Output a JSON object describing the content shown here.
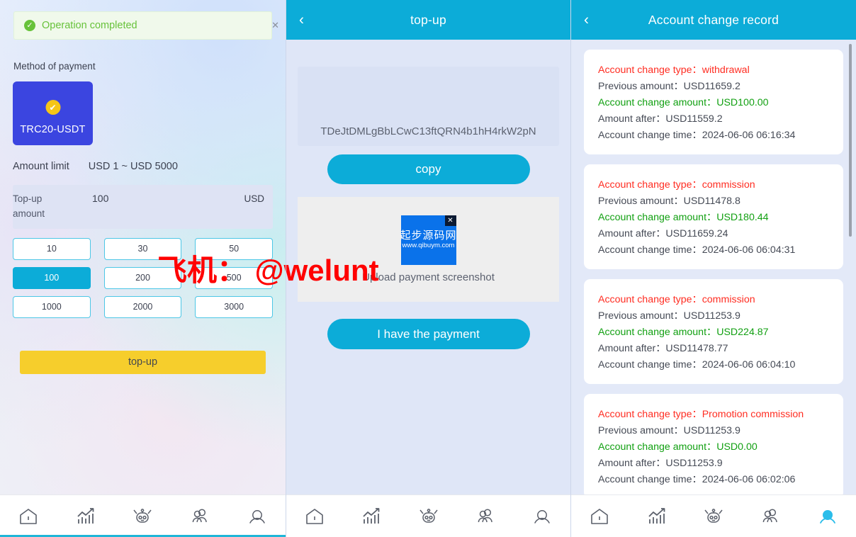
{
  "left_panel": {
    "toast": {
      "text": "Operation completed",
      "icon": "check-circle-icon",
      "close": "✕",
      "color": "#67c23a"
    },
    "method_label": "Method of payment",
    "method": {
      "name": "TRC20-USDT",
      "selected_badge": "✔",
      "color": "#3b45e0",
      "badge_color": "#f5c518"
    },
    "limit_label": "Amount limit",
    "limit_value": "USD 1 ~ USD 5000",
    "amount_label": "Top-up amount",
    "amount_value": "100",
    "amount_placeholder": "",
    "amount_unit": "USD",
    "quick_amounts": [
      "10",
      "30",
      "50",
      "100",
      "200",
      "500",
      "1000",
      "2000",
      "3000"
    ],
    "quick_selected": "100",
    "submit_label": "top-up",
    "submit_color": "#f6ce2c"
  },
  "mid_panel": {
    "header": {
      "back": "‹",
      "title": "top-up"
    },
    "address": "TDeJtDMLgBbLCwC13ftQRN4b1hH4rkW2pN",
    "copy_label": "copy",
    "upload_label": "Upload payment screenshot",
    "thumbnail": {
      "cn_text": "起步源码网",
      "url_text": "www.qibuym.com",
      "close": "✕",
      "color": "#0a72ea"
    },
    "paid_label": "I have the payment",
    "accent_color": "#0cacd8"
  },
  "right_panel": {
    "header": {
      "back": "‹",
      "title": "Account change record"
    },
    "labels": {
      "type": "Account change type：",
      "previous": "Previous amount：",
      "amount": "Account change amount：",
      "after": "Amount after：",
      "time": "Account change time："
    },
    "type_color": "#ff2d22",
    "amount_color": "#12a012",
    "records": [
      {
        "type": "withdrawal",
        "previous": "USD11659.2",
        "amount": "USD100.00",
        "after": "USD11559.2",
        "time": "2024-06-06 06:16:34"
      },
      {
        "type": "commission",
        "previous": "USD11478.8",
        "amount": "USD180.44",
        "after": "USD11659.24",
        "time": "2024-06-06 06:04:31"
      },
      {
        "type": "commission",
        "previous": "USD11253.9",
        "amount": "USD224.87",
        "after": "USD11478.77",
        "time": "2024-06-06 06:04:10"
      },
      {
        "type": "Promotion commission",
        "previous": "USD11253.9",
        "amount": "USD0.00",
        "after": "USD11253.9",
        "time": "2024-06-06 06:02:06"
      }
    ]
  },
  "bottom_nav": {
    "items": [
      {
        "icon": "home-icon",
        "active": false
      },
      {
        "icon": "chart-icon",
        "active": false
      },
      {
        "icon": "robot-icon",
        "active": false
      },
      {
        "icon": "users-icon",
        "active": false
      },
      {
        "icon": "profile-icon",
        "active": false
      }
    ],
    "right_active_index": 4,
    "active_color": "#1fb6d8",
    "inactive_color": "#5b606b"
  },
  "watermark": {
    "text": "飞机： @welunt",
    "color": "#ff0000"
  }
}
